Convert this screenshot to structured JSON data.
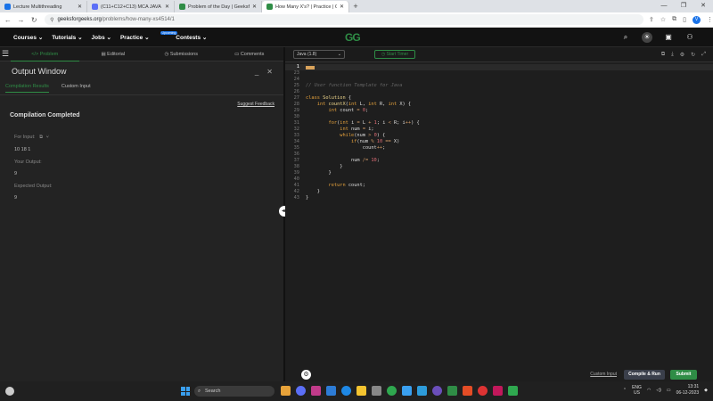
{
  "browser": {
    "tabs": [
      {
        "title": "Lecture Multithreading",
        "color": "#1a73e8",
        "active": false
      },
      {
        "title": "(C11+C12+C13) MCA JAVA (C1",
        "color": "#5b6ff7",
        "active": false
      },
      {
        "title": "Problem of the Day | GeeksforG",
        "color": "#2f8d46",
        "active": false
      },
      {
        "title": "How Many X's? | Practice | Geek",
        "color": "#2f8d46",
        "active": true
      }
    ],
    "new_tab": "+",
    "url_host": "geeksforgeeks.org",
    "url_path": "/problems/how-many-xs4514/1",
    "profile_initial": "V"
  },
  "gfg_nav": {
    "menu": [
      {
        "label": "Courses",
        "badge": ""
      },
      {
        "label": "Tutorials",
        "badge": ""
      },
      {
        "label": "Jobs",
        "badge": ""
      },
      {
        "label": "Practice",
        "badge": ""
      },
      {
        "label": "Contests",
        "badge": "Upcoming"
      }
    ],
    "logo": "GG"
  },
  "left": {
    "tabs": [
      "Problem",
      "Editorial",
      "Submissions",
      "Comments"
    ],
    "output_title": "Output Window",
    "result_tabs": [
      "Compilation Results",
      "Custom Input"
    ],
    "feedback": "Suggest Feedback",
    "status": "Compilation Completed",
    "for_input_label": "For Input:",
    "for_input_value": "10 18 1",
    "your_output_label": "Your Output:",
    "your_output_value": "9",
    "expected_label": "Expected Output:",
    "expected_value": "9"
  },
  "editor": {
    "language": "Java (1.8)",
    "timer": "Start Timer",
    "lines": [
      {
        "n": "1",
        "code": [
          {
            "t": "fold",
            "v": ""
          }
        ]
      },
      {
        "n": "23",
        "code": []
      },
      {
        "n": "24",
        "code": []
      },
      {
        "n": "25",
        "code": [
          {
            "t": "cm",
            "v": "// User function Template for Java"
          }
        ]
      },
      {
        "n": "26",
        "code": []
      },
      {
        "n": "27",
        "code": [
          {
            "t": "kw",
            "v": "class "
          },
          {
            "t": "id",
            "v": "Solution "
          },
          {
            "t": "tx",
            "v": "{"
          }
        ]
      },
      {
        "n": "28",
        "code": [
          {
            "t": "tx",
            "v": "    "
          },
          {
            "t": "kw",
            "v": "int "
          },
          {
            "t": "id",
            "v": "countX"
          },
          {
            "t": "tx",
            "v": "("
          },
          {
            "t": "kw",
            "v": "int "
          },
          {
            "t": "tx",
            "v": "L, "
          },
          {
            "t": "kw",
            "v": "int "
          },
          {
            "t": "tx",
            "v": "R, "
          },
          {
            "t": "kw",
            "v": "int "
          },
          {
            "t": "tx",
            "v": "X) {"
          }
        ]
      },
      {
        "n": "29",
        "code": [
          {
            "t": "tx",
            "v": "        "
          },
          {
            "t": "kw",
            "v": "int "
          },
          {
            "t": "tx",
            "v": "count "
          },
          {
            "t": "op",
            "v": "= "
          },
          {
            "t": "num",
            "v": "0"
          },
          {
            "t": "tx",
            "v": ";"
          }
        ]
      },
      {
        "n": "30",
        "code": []
      },
      {
        "n": "31",
        "code": [
          {
            "t": "tx",
            "v": "        "
          },
          {
            "t": "kw",
            "v": "for"
          },
          {
            "t": "tx",
            "v": "("
          },
          {
            "t": "kw",
            "v": "int "
          },
          {
            "t": "tx",
            "v": "i "
          },
          {
            "t": "op",
            "v": "= "
          },
          {
            "t": "tx",
            "v": "L "
          },
          {
            "t": "op",
            "v": "+ "
          },
          {
            "t": "num",
            "v": "1"
          },
          {
            "t": "tx",
            "v": "; i "
          },
          {
            "t": "op",
            "v": "< "
          },
          {
            "t": "tx",
            "v": "R; i"
          },
          {
            "t": "op",
            "v": "++"
          },
          {
            "t": "tx",
            "v": ") {"
          }
        ]
      },
      {
        "n": "32",
        "code": [
          {
            "t": "tx",
            "v": "            "
          },
          {
            "t": "kw",
            "v": "int "
          },
          {
            "t": "tx",
            "v": "num "
          },
          {
            "t": "op",
            "v": "= "
          },
          {
            "t": "tx",
            "v": "i;"
          }
        ]
      },
      {
        "n": "33",
        "code": [
          {
            "t": "tx",
            "v": "            "
          },
          {
            "t": "kw",
            "v": "while"
          },
          {
            "t": "tx",
            "v": "(num "
          },
          {
            "t": "op",
            "v": "> "
          },
          {
            "t": "num",
            "v": "0"
          },
          {
            "t": "tx",
            "v": ") {"
          }
        ]
      },
      {
        "n": "34",
        "code": [
          {
            "t": "tx",
            "v": "                "
          },
          {
            "t": "kw",
            "v": "if"
          },
          {
            "t": "tx",
            "v": "(num "
          },
          {
            "t": "op",
            "v": "% "
          },
          {
            "t": "num",
            "v": "10 "
          },
          {
            "t": "op",
            "v": "== "
          },
          {
            "t": "tx",
            "v": "X)"
          }
        ]
      },
      {
        "n": "35",
        "code": [
          {
            "t": "tx",
            "v": "                    count"
          },
          {
            "t": "op",
            "v": "++"
          },
          {
            "t": "tx",
            "v": ";"
          }
        ]
      },
      {
        "n": "36",
        "code": []
      },
      {
        "n": "37",
        "code": [
          {
            "t": "tx",
            "v": "                num "
          },
          {
            "t": "op",
            "v": "/= "
          },
          {
            "t": "num",
            "v": "10"
          },
          {
            "t": "tx",
            "v": ";"
          }
        ]
      },
      {
        "n": "38",
        "code": [
          {
            "t": "tx",
            "v": "            }"
          }
        ]
      },
      {
        "n": "39",
        "code": [
          {
            "t": "tx",
            "v": "        }"
          }
        ]
      },
      {
        "n": "40",
        "code": []
      },
      {
        "n": "41",
        "code": [
          {
            "t": "tx",
            "v": "        "
          },
          {
            "t": "kw",
            "v": "return "
          },
          {
            "t": "tx",
            "v": "count;"
          }
        ]
      },
      {
        "n": "42",
        "code": [
          {
            "t": "tx",
            "v": "    }"
          }
        ]
      },
      {
        "n": "43",
        "code": [
          {
            "t": "tx",
            "v": "}"
          }
        ]
      }
    ],
    "custom_input": "Custom Input",
    "compile_run": "Compile & Run",
    "submit": "Submit"
  },
  "taskbar": {
    "search": "Search",
    "apps": [
      "#e8a33a",
      "#5b6ff7",
      "#c13b8a",
      "#2d7cd6",
      "#1e88e5",
      "#f4c430",
      "#888888",
      "#2fa84f",
      "#3aa0f0",
      "#2d9cdb",
      "#6b4fbb",
      "#2f8d46",
      "#e44d26",
      "#d33",
      "#c2185b",
      "#2fa84f"
    ],
    "lang_top": "ENG",
    "lang_bottom": "US",
    "time": "13:31",
    "date": "06-12-2023"
  }
}
